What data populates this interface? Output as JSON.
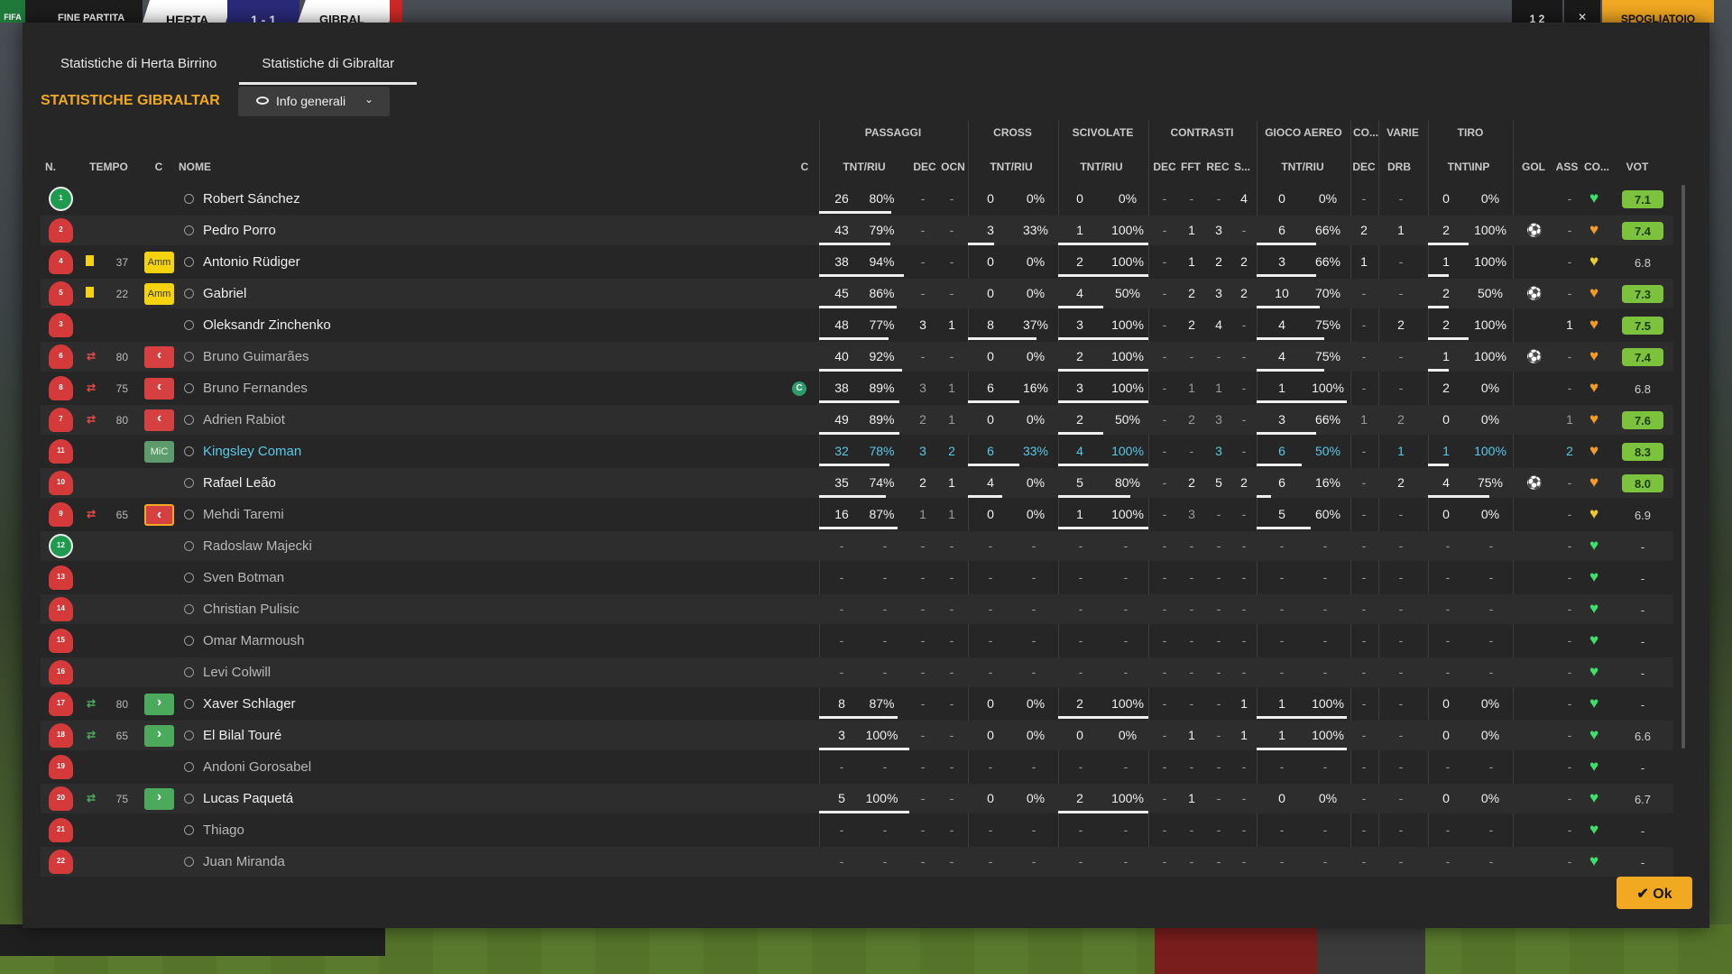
{
  "colors": {
    "accent": "#f2a922",
    "vote_high": "#7cc23c",
    "card_yellow": "#f5d40f",
    "sub_out": "#d64040",
    "sub_in": "#4caa5c"
  },
  "topbar": {
    "logo": "FIFA",
    "status": "FINE PARTITA",
    "team1": "HERTA",
    "score": "1 - 1",
    "team2": "GIBRAL",
    "clock": "1 2",
    "close": "✕",
    "action": "SPOGLIATOIO"
  },
  "tabs": [
    {
      "label": "Statistiche di Herta Birrino"
    },
    {
      "label": "Statistiche di Gibraltar"
    }
  ],
  "section_title": "STATISTICHE GIBRALTAR",
  "dropdown_label": "Info generali",
  "groups": [
    "PASSAGGI",
    "CROSS",
    "SCIVOLATE",
    "CONTRASTI",
    "GIOCO AEREO",
    "CO...",
    "VARIE",
    "TIRO"
  ],
  "columns": [
    "N.",
    "TEMPO",
    "C",
    "NOME",
    "C",
    "TNT/RIU",
    "DEC",
    "OCN",
    "TNT/RIU",
    "TNT/RIU",
    "DEC",
    "FFT",
    "REC",
    "S...",
    "TNT/RIU",
    "DEC",
    "DRB",
    "TNT\\INP",
    "GOL",
    "ASS",
    "CO...",
    "VOT"
  ],
  "ok_label": "Ok",
  "players": [
    {
      "num": "1",
      "gk": true,
      "tempo": "",
      "card": "",
      "tag": "",
      "name": "Robert Sánchez",
      "pass_t": "26",
      "pass_p": "80%",
      "dec": "-",
      "ocn": "-",
      "cross_t": "0",
      "cross_p": "0%",
      "sciv_t": "0",
      "sciv_p": "0%",
      "c_dec": "-",
      "c_fft": "-",
      "c_rec": "-",
      "c_s": "4",
      "air_t": "0",
      "air_p": "0%",
      "co_dec": "-",
      "drb": "-",
      "tiro_t": "0",
      "tiro_p": "0%",
      "gol": "",
      "ass": "-",
      "heart": "green",
      "vot": "7.1",
      "hi": true
    },
    {
      "num": "2",
      "tempo": "",
      "card": "",
      "tag": "",
      "name": "Pedro Porro",
      "pass_t": "43",
      "pass_p": "79%",
      "dec": "-",
      "ocn": "-",
      "cross_t": "3",
      "cross_p": "33%",
      "sciv_t": "1",
      "sciv_p": "100%",
      "c_dec": "-",
      "c_fft": "1",
      "c_rec": "3",
      "c_s": "-",
      "air_t": "6",
      "air_p": "66%",
      "co_dec": "2",
      "drb": "1",
      "tiro_t": "2",
      "tiro_p": "100%",
      "gol": "gear",
      "ass": "-",
      "heart": "orange",
      "vot": "7.4",
      "hi": true
    },
    {
      "num": "4",
      "tempo": "37",
      "card": "y",
      "tag": "Amm",
      "name": "Antonio Rüdiger",
      "pass_t": "38",
      "pass_p": "94%",
      "dec": "-",
      "ocn": "-",
      "cross_t": "0",
      "cross_p": "0%",
      "sciv_t": "2",
      "sciv_p": "100%",
      "c_dec": "-",
      "c_fft": "1",
      "c_rec": "2",
      "c_s": "2",
      "air_t": "3",
      "air_p": "66%",
      "co_dec": "1",
      "drb": "-",
      "tiro_t": "1",
      "tiro_p": "100%",
      "gol": "",
      "ass": "-",
      "heart": "yellow",
      "vot": "6.8",
      "hi": false
    },
    {
      "num": "5",
      "tempo": "22",
      "card": "y",
      "tag": "Amm",
      "name": "Gabriel",
      "pass_t": "45",
      "pass_p": "86%",
      "dec": "-",
      "ocn": "-",
      "cross_t": "0",
      "cross_p": "0%",
      "sciv_t": "4",
      "sciv_p": "50%",
      "c_dec": "-",
      "c_fft": "2",
      "c_rec": "3",
      "c_s": "2",
      "air_t": "10",
      "air_p": "70%",
      "co_dec": "-",
      "drb": "-",
      "tiro_t": "2",
      "tiro_p": "50%",
      "gol": "gear",
      "ass": "-",
      "heart": "orange",
      "vot": "7.3",
      "hi": true
    },
    {
      "num": "3",
      "tempo": "",
      "card": "",
      "tag": "",
      "name": "Oleksandr Zinchenko",
      "pass_t": "48",
      "pass_p": "77%",
      "dec": "3",
      "ocn": "1",
      "cross_t": "8",
      "cross_p": "37%",
      "sciv_t": "3",
      "sciv_p": "100%",
      "c_dec": "-",
      "c_fft": "2",
      "c_rec": "4",
      "c_s": "-",
      "air_t": "4",
      "air_p": "75%",
      "co_dec": "-",
      "drb": "2",
      "tiro_t": "2",
      "tiro_p": "100%",
      "gol": "",
      "ass": "1",
      "heart": "orange",
      "vot": "7.5",
      "hi": true
    },
    {
      "num": "6",
      "tempo": "80",
      "card": "",
      "sub": "out",
      "tag": "out",
      "name": "Bruno Guimarães",
      "pass_t": "40",
      "pass_p": "92%",
      "dec": "-",
      "ocn": "-",
      "cross_t": "0",
      "cross_p": "0%",
      "sciv_t": "2",
      "sciv_p": "100%",
      "c_dec": "-",
      "c_fft": "-",
      "c_rec": "-",
      "c_s": "-",
      "air_t": "4",
      "air_p": "75%",
      "co_dec": "-",
      "drb": "-",
      "tiro_t": "1",
      "tiro_p": "100%",
      "gol": "gear",
      "ass": "-",
      "heart": "orange",
      "vot": "7.4",
      "hi": true,
      "dim": true
    },
    {
      "num": "8",
      "tempo": "75",
      "card": "",
      "sub": "out",
      "tag": "out",
      "name": "Bruno Fernandes",
      "capt": "C",
      "pass_t": "38",
      "pass_p": "89%",
      "dec": "3",
      "ocn": "1",
      "cross_t": "6",
      "cross_p": "16%",
      "sciv_t": "3",
      "sciv_p": "100%",
      "c_dec": "-",
      "c_fft": "1",
      "c_rec": "1",
      "c_s": "-",
      "air_t": "1",
      "air_p": "100%",
      "co_dec": "-",
      "drb": "-",
      "tiro_t": "2",
      "tiro_p": "0%",
      "gol": "",
      "ass": "-",
      "heart": "orange",
      "vot": "6.8",
      "hi": false,
      "dim": true
    },
    {
      "num": "7",
      "tempo": "80",
      "card": "",
      "sub": "out",
      "tag": "out",
      "name": "Adrien Rabiot",
      "pass_t": "49",
      "pass_p": "89%",
      "dec": "2",
      "ocn": "1",
      "cross_t": "0",
      "cross_p": "0%",
      "sciv_t": "2",
      "sciv_p": "50%",
      "c_dec": "-",
      "c_fft": "2",
      "c_rec": "3",
      "c_s": "-",
      "air_t": "3",
      "air_p": "66%",
      "co_dec": "1",
      "drb": "2",
      "tiro_t": "0",
      "tiro_p": "0%",
      "gol": "",
      "ass": "1",
      "heart": "orange",
      "vot": "7.6",
      "hi": true,
      "dim": true
    },
    {
      "num": "11",
      "tempo": "",
      "card": "",
      "tag": "MiC",
      "name": "Kingsley Coman",
      "pass_t": "32",
      "pass_p": "78%",
      "dec": "3",
      "ocn": "2",
      "cross_t": "6",
      "cross_p": "33%",
      "sciv_t": "4",
      "sciv_p": "100%",
      "c_dec": "-",
      "c_fft": "-",
      "c_rec": "3",
      "c_s": "-",
      "air_t": "6",
      "air_p": "50%",
      "co_dec": "-",
      "drb": "1",
      "tiro_t": "1",
      "tiro_p": "100%",
      "gol": "",
      "ass": "2",
      "heart": "orange",
      "vot": "8.3",
      "hi": true,
      "cyan": true
    },
    {
      "num": "10",
      "tempo": "",
      "card": "",
      "tag": "",
      "name": "Rafael Leão",
      "pass_t": "35",
      "pass_p": "74%",
      "dec": "2",
      "ocn": "1",
      "cross_t": "4",
      "cross_p": "0%",
      "sciv_t": "5",
      "sciv_p": "80%",
      "c_dec": "-",
      "c_fft": "2",
      "c_rec": "5",
      "c_s": "2",
      "air_t": "6",
      "air_p": "16%",
      "co_dec": "-",
      "drb": "2",
      "tiro_t": "4",
      "tiro_p": "75%",
      "gol": "gear",
      "ass": "-",
      "heart": "orange",
      "vot": "8.0",
      "hi": true
    },
    {
      "num": "9",
      "tempo": "65",
      "card": "",
      "sub": "out",
      "tag": "outy",
      "name": "Mehdi Taremi",
      "pass_t": "16",
      "pass_p": "87%",
      "dec": "1",
      "ocn": "1",
      "cross_t": "0",
      "cross_p": "0%",
      "sciv_t": "1",
      "sciv_p": "100%",
      "c_dec": "-",
      "c_fft": "3",
      "c_rec": "-",
      "c_s": "-",
      "air_t": "5",
      "air_p": "60%",
      "co_dec": "-",
      "drb": "-",
      "tiro_t": "0",
      "tiro_p": "0%",
      "gol": "",
      "ass": "-",
      "heart": "yellow",
      "vot": "6.9",
      "hi": false,
      "dim": true
    },
    {
      "num": "12",
      "gk": true,
      "tempo": "",
      "card": "",
      "tag": "",
      "name": "Radoslaw Majecki",
      "empty": true,
      "heart": "green",
      "vot": "-",
      "dim": true
    },
    {
      "num": "13",
      "tempo": "",
      "card": "",
      "tag": "",
      "name": "Sven Botman",
      "empty": true,
      "heart": "green",
      "vot": "-",
      "dim": true
    },
    {
      "num": "14",
      "tempo": "",
      "card": "",
      "tag": "",
      "name": "Christian Pulisic",
      "empty": true,
      "heart": "green",
      "vot": "-",
      "dim": true
    },
    {
      "num": "15",
      "tempo": "",
      "card": "",
      "tag": "",
      "name": "Omar Marmoush",
      "empty": true,
      "heart": "green",
      "vot": "-",
      "dim": true
    },
    {
      "num": "16",
      "tempo": "",
      "card": "",
      "tag": "",
      "name": "Levi Colwill",
      "empty": true,
      "heart": "green",
      "vot": "-",
      "dim": true
    },
    {
      "num": "17",
      "tempo": "80",
      "card": "",
      "sub": "in",
      "tag": "in",
      "name": "Xaver Schlager",
      "pass_t": "8",
      "pass_p": "87%",
      "dec": "-",
      "ocn": "-",
      "cross_t": "0",
      "cross_p": "0%",
      "sciv_t": "2",
      "sciv_p": "100%",
      "c_dec": "-",
      "c_fft": "-",
      "c_rec": "-",
      "c_s": "1",
      "air_t": "1",
      "air_p": "100%",
      "co_dec": "-",
      "drb": "-",
      "tiro_t": "0",
      "tiro_p": "0%",
      "gol": "",
      "ass": "-",
      "heart": "green",
      "vot": "-",
      "hi": false
    },
    {
      "num": "18",
      "tempo": "65",
      "card": "",
      "sub": "in",
      "tag": "in",
      "name": "El Bilal Touré",
      "pass_t": "3",
      "pass_p": "100%",
      "dec": "-",
      "ocn": "-",
      "cross_t": "0",
      "cross_p": "0%",
      "sciv_t": "0",
      "sciv_p": "0%",
      "c_dec": "-",
      "c_fft": "1",
      "c_rec": "-",
      "c_s": "1",
      "air_t": "1",
      "air_p": "100%",
      "co_dec": "-",
      "drb": "-",
      "tiro_t": "0",
      "tiro_p": "0%",
      "gol": "",
      "ass": "-",
      "heart": "green",
      "vot": "6.6",
      "hi": false
    },
    {
      "num": "19",
      "tempo": "",
      "card": "",
      "tag": "",
      "name": "Andoni Gorosabel",
      "empty": true,
      "heart": "green",
      "vot": "-",
      "dim": true
    },
    {
      "num": "20",
      "tempo": "75",
      "card": "",
      "sub": "in",
      "tag": "in",
      "name": "Lucas Paquetá",
      "pass_t": "5",
      "pass_p": "100%",
      "dec": "-",
      "ocn": "-",
      "cross_t": "0",
      "cross_p": "0%",
      "sciv_t": "2",
      "sciv_p": "100%",
      "c_dec": "-",
      "c_fft": "1",
      "c_rec": "-",
      "c_s": "-",
      "air_t": "0",
      "air_p": "0%",
      "co_dec": "-",
      "drb": "-",
      "tiro_t": "0",
      "tiro_p": "0%",
      "gol": "",
      "ass": "-",
      "heart": "green",
      "vot": "6.7",
      "hi": false
    },
    {
      "num": "21",
      "tempo": "",
      "card": "",
      "tag": "",
      "name": "Thiago",
      "empty": true,
      "heart": "green",
      "vot": "-",
      "dim": true
    },
    {
      "num": "22",
      "tempo": "",
      "card": "",
      "tag": "",
      "name": "Juan Miranda",
      "empty": true,
      "heart": "green",
      "vot": "-",
      "dim": true
    }
  ]
}
